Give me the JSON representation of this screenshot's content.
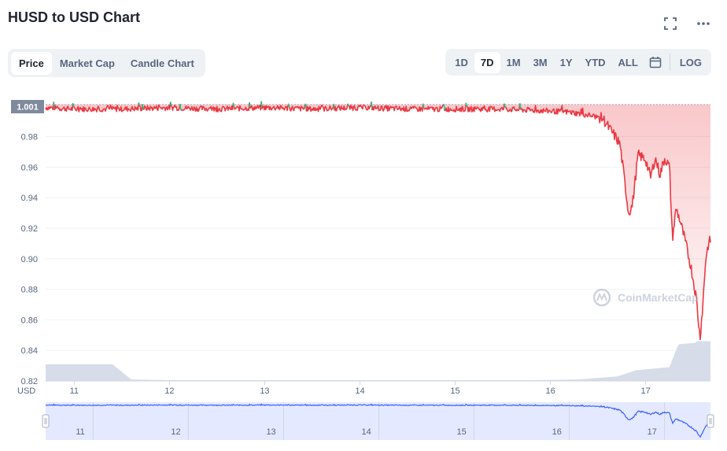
{
  "header": {
    "title": "HUSD to USD Chart"
  },
  "tabs": [
    {
      "label": "Price",
      "active": true
    },
    {
      "label": "Market Cap",
      "active": false
    },
    {
      "label": "Candle Chart",
      "active": false
    }
  ],
  "ranges": [
    {
      "label": "1D",
      "active": false
    },
    {
      "label": "7D",
      "active": true
    },
    {
      "label": "1M",
      "active": false
    },
    {
      "label": "3M",
      "active": false
    },
    {
      "label": "1Y",
      "active": false
    },
    {
      "label": "YTD",
      "active": false
    },
    {
      "label": "ALL",
      "active": false
    }
  ],
  "log_label": "LOG",
  "watermark": "CoinMarketCap",
  "chart_data": {
    "type": "line",
    "currency_label": "USD",
    "current_price_label": "1.001",
    "baseline": 1.001,
    "ylim": [
      0.82,
      1.005
    ],
    "yticks": [
      0.82,
      0.84,
      0.86,
      0.88,
      0.9,
      0.92,
      0.94,
      0.96,
      0.98
    ],
    "xlim": [
      10.7,
      17.68
    ],
    "xticks": [
      {
        "value": 11,
        "label": "11"
      },
      {
        "value": 12,
        "label": "12"
      },
      {
        "value": 13,
        "label": "13"
      },
      {
        "value": 14,
        "label": "14"
      },
      {
        "value": 15,
        "label": "15"
      },
      {
        "value": 16,
        "label": "16"
      },
      {
        "value": 17,
        "label": "17"
      }
    ],
    "colors": {
      "up": "#16c784",
      "down": "#ea3943",
      "volume": "#cfd6e4",
      "navigator": "#3861fb",
      "navigator_fill": "#e4e9ff"
    },
    "price": {
      "x": [
        10.7,
        11.0,
        11.5,
        12.0,
        12.5,
        13.0,
        13.5,
        14.0,
        14.5,
        15.0,
        15.5,
        15.9,
        16.2,
        16.4,
        16.55,
        16.62,
        16.68,
        16.73,
        16.77,
        16.82,
        16.86,
        16.92,
        17.0,
        17.05,
        17.1,
        17.15,
        17.2,
        17.25,
        17.28,
        17.32,
        17.36,
        17.42,
        17.48,
        17.53,
        17.57,
        17.6,
        17.63,
        17.66,
        17.68
      ],
      "y": [
        0.999,
        0.998,
        0.998,
        0.999,
        0.998,
        0.999,
        0.998,
        0.999,
        0.998,
        0.998,
        0.998,
        0.997,
        0.996,
        0.994,
        0.992,
        0.985,
        0.98,
        0.975,
        0.955,
        0.93,
        0.935,
        0.968,
        0.965,
        0.953,
        0.966,
        0.955,
        0.966,
        0.96,
        0.913,
        0.933,
        0.925,
        0.91,
        0.893,
        0.875,
        0.848,
        0.87,
        0.9,
        0.91,
        0.912
      ]
    },
    "volume": {
      "x": [
        10.7,
        11.4,
        11.6,
        12.0,
        13.0,
        14.0,
        15.0,
        15.8,
        16.3,
        16.7,
        16.9,
        17.25,
        17.33,
        17.35,
        17.52,
        17.54,
        17.68
      ],
      "y": [
        0.831,
        0.831,
        0.821,
        0.8205,
        0.8205,
        0.8205,
        0.8205,
        0.8205,
        0.821,
        0.823,
        0.827,
        0.829,
        0.842,
        0.844,
        0.845,
        0.846,
        0.846
      ]
    }
  }
}
